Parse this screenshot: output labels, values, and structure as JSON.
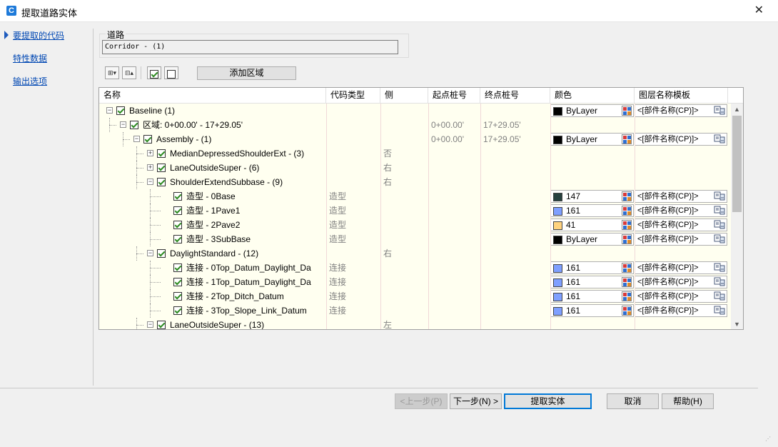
{
  "window": {
    "title": "提取道路实体",
    "app_icon": "C",
    "close": "✕"
  },
  "nav": {
    "items": [
      "要提取的代码",
      "特性数据",
      "输出选项"
    ]
  },
  "road": {
    "label": "道路",
    "value": "Corridor - (1)"
  },
  "toolbar": {
    "add_region": "添加区域"
  },
  "grid": {
    "columns": [
      "名称",
      "代码类型",
      "侧",
      "起点桩号",
      "终点桩号",
      "颜色",
      "图层名称模板"
    ],
    "rows": [
      {
        "level": 0,
        "toggle": "−",
        "name": "Baseline (1)",
        "type": "",
        "side": "",
        "start": "",
        "end": "",
        "color_name": "ByLayer",
        "color_hex": "#000000",
        "layer": "<[部件名称(CP)]>"
      },
      {
        "level": 1,
        "toggle": "−",
        "name": "区域: 0+00.00' - 17+29.05'",
        "type": "",
        "side": "",
        "start": "0+00.00'",
        "end": "17+29.05'",
        "color_name": "",
        "color_hex": "",
        "layer": ""
      },
      {
        "level": 2,
        "toggle": "−",
        "name": "Assembly - (1)",
        "type": "",
        "side": "",
        "start": "0+00.00'",
        "end": "17+29.05'",
        "color_name": "ByLayer",
        "color_hex": "#000000",
        "layer": "<[部件名称(CP)]>"
      },
      {
        "level": 3,
        "toggle": "+",
        "name": "MedianDepressedShoulderExt - (3)",
        "type": "",
        "side": "否",
        "start": "",
        "end": "",
        "color_name": "",
        "color_hex": "",
        "layer": ""
      },
      {
        "level": 3,
        "toggle": "+",
        "name": "LaneOutsideSuper - (6)",
        "type": "",
        "side": "右",
        "start": "",
        "end": "",
        "color_name": "",
        "color_hex": "",
        "layer": ""
      },
      {
        "level": 3,
        "toggle": "−",
        "name": "ShoulderExtendSubbase - (9)",
        "type": "",
        "side": "右",
        "start": "",
        "end": "",
        "color_name": "",
        "color_hex": "",
        "layer": ""
      },
      {
        "level": 4,
        "toggle": "",
        "name": "造型 - 0Base",
        "type": "造型",
        "side": "",
        "start": "",
        "end": "",
        "color_name": "147",
        "color_hex": "#27413f",
        "layer": "<[部件名称(CP)]>"
      },
      {
        "level": 4,
        "toggle": "",
        "name": "造型 - 1Pave1",
        "type": "造型",
        "side": "",
        "start": "",
        "end": "",
        "color_name": "161",
        "color_hex": "#7f9fff",
        "layer": "<[部件名称(CP)]>"
      },
      {
        "level": 4,
        "toggle": "",
        "name": "造型 - 2Pave2",
        "type": "造型",
        "side": "",
        "start": "",
        "end": "",
        "color_name": "41",
        "color_hex": "#ffd27f",
        "layer": "<[部件名称(CP)]>"
      },
      {
        "level": 4,
        "toggle": "",
        "name": "造型 - 3SubBase",
        "type": "造型",
        "side": "",
        "start": "",
        "end": "",
        "color_name": "ByLayer",
        "color_hex": "#000000",
        "layer": "<[部件名称(CP)]>"
      },
      {
        "level": 3,
        "toggle": "−",
        "name": "DaylightStandard - (12)",
        "type": "",
        "side": "右",
        "start": "",
        "end": "",
        "color_name": "",
        "color_hex": "",
        "layer": ""
      },
      {
        "level": 4,
        "toggle": "",
        "name": "连接 - 0Top_Datum_Daylight_Da",
        "type": "连接",
        "side": "",
        "start": "",
        "end": "",
        "color_name": "161",
        "color_hex": "#7f9fff",
        "layer": "<[部件名称(CP)]>"
      },
      {
        "level": 4,
        "toggle": "",
        "name": "连接 - 1Top_Datum_Daylight_Da",
        "type": "连接",
        "side": "",
        "start": "",
        "end": "",
        "color_name": "161",
        "color_hex": "#7f9fff",
        "layer": "<[部件名称(CP)]>"
      },
      {
        "level": 4,
        "toggle": "",
        "name": "连接 - 2Top_Ditch_Datum",
        "type": "连接",
        "side": "",
        "start": "",
        "end": "",
        "color_name": "161",
        "color_hex": "#7f9fff",
        "layer": "<[部件名称(CP)]>"
      },
      {
        "level": 4,
        "toggle": "",
        "name": "连接 - 3Top_Slope_Link_Datum",
        "type": "连接",
        "side": "",
        "start": "",
        "end": "",
        "color_name": "161",
        "color_hex": "#7f9fff",
        "layer": "<[部件名称(CP)]>"
      },
      {
        "level": 3,
        "toggle": "−",
        "name": "LaneOutsideSuper - (13)",
        "type": "",
        "side": "左",
        "start": "",
        "end": "",
        "color_name": "",
        "color_hex": "",
        "layer": ""
      }
    ]
  },
  "buttons": {
    "back": "<上一步(P)",
    "next": "下一步(N) >",
    "extract": "提取实体",
    "cancel": "取消",
    "help": "帮助(H)"
  }
}
